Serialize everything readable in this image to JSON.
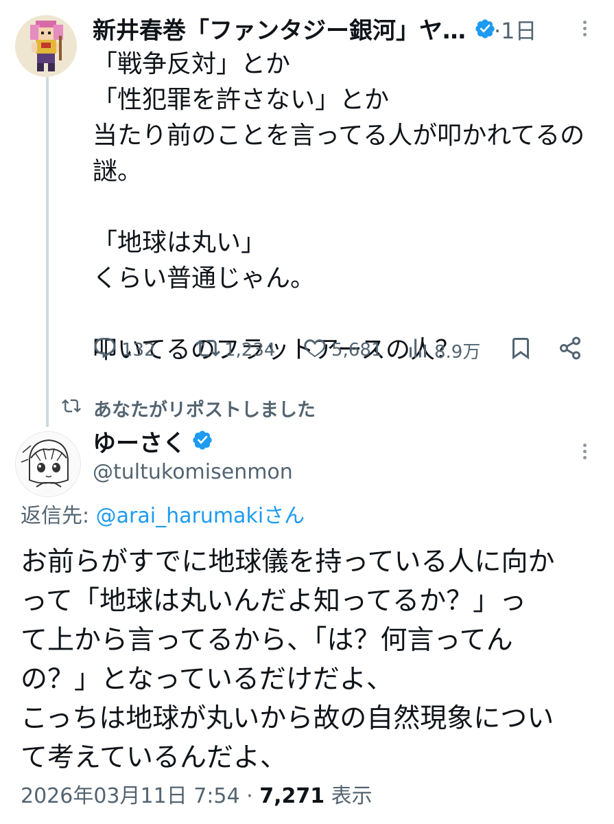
{
  "tweet1": {
    "author_name": "新井春巻「ファンタジー銀河」ヤ…",
    "time": "·1日",
    "text": "「戦争反対」とか\n「性犯罪を許さない」とか\n当たり前のことを言ってる人が叩かれてるの\n謎。\n\n「地球は丸い」\nくらい普通じゃん。\n\n叩いてるのフラットアースの人？",
    "stats": {
      "replies": "132",
      "reposts": "1,234",
      "likes": "5,681",
      "views": "8.9万"
    }
  },
  "repost_notice": "あなたがリポストしました",
  "tweet2": {
    "author_name": "ゆーさく",
    "handle": "@tultukomisenmon",
    "replying_prefix": "返信先: ",
    "replying_to": "@arai_harumakiさん",
    "text": "お前らがすでに地球儀を持っている人に向か\nって「地球は丸いんだよ知ってるか？」っ\nて上から言ってるから、「は？何言ってん\nの？」となっているだけだよ、\nこっちは地球が丸いから故の自然現象につい\nて考えているんだよ、",
    "date": "2026年03月11日 7:54 · ",
    "view_count": "7,271",
    "view_label": " 表示"
  },
  "colors": {
    "verified": "#1d9bf0",
    "secondary_text": "#536471",
    "link": "#1d9bf0"
  },
  "icons": [
    "verified-badge-icon",
    "more-icon",
    "reply-icon",
    "repost-icon",
    "like-icon",
    "views-icon",
    "bookmark-icon",
    "share-icon"
  ]
}
